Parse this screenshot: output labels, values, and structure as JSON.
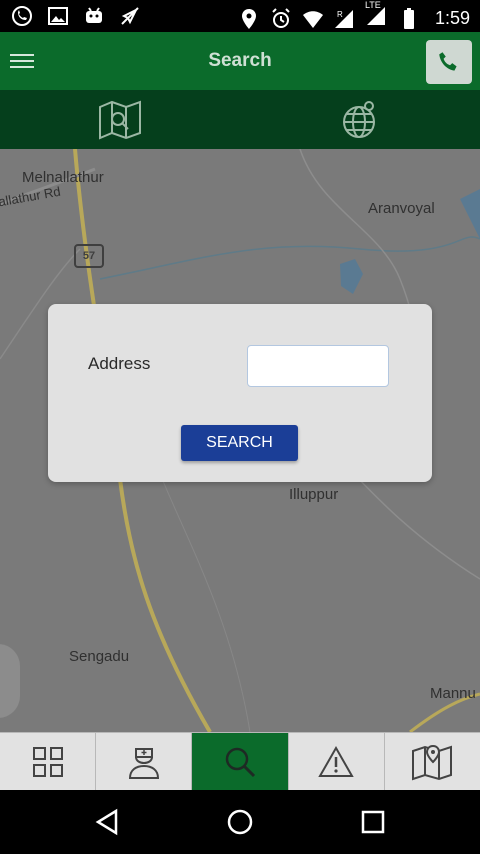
{
  "status_bar": {
    "time": "1:59",
    "left_icons": [
      "whatsapp-icon",
      "gallery-icon",
      "android-icon",
      "no-gps-icon"
    ],
    "right_icons": [
      "location-icon",
      "alarm-icon",
      "wifi-icon",
      "signal-roaming-icon",
      "signal-icon",
      "battery-icon"
    ],
    "signal_tag": "LTE"
  },
  "header": {
    "title": "Search",
    "menu_icon": "hamburger-icon",
    "phone_icon": "phone-icon",
    "bar_color": "#0b6b2b"
  },
  "sub_tabs": [
    {
      "icon": "map-search-icon"
    },
    {
      "icon": "globe-icon"
    }
  ],
  "map": {
    "labels": [
      "Melnallathur",
      "allathur Rd",
      "Aranvoyal",
      "Illuppur",
      "Sengadu",
      "Mannu"
    ],
    "route_badge": "57"
  },
  "dialog": {
    "address_label": "Address",
    "address_value": "",
    "search_button": "SEARCH"
  },
  "bottom_tabs": [
    {
      "icon": "grid-icon",
      "active": false
    },
    {
      "icon": "nurse-icon",
      "active": false
    },
    {
      "icon": "search-icon",
      "active": true
    },
    {
      "icon": "warning-icon",
      "active": false
    },
    {
      "icon": "map-pin-icon",
      "active": false
    }
  ],
  "nav_bar": {
    "buttons": [
      "back-icon",
      "home-icon",
      "recents-icon"
    ]
  },
  "colors": {
    "primary_green": "#0b6b2b",
    "dark_green": "#053f1c",
    "button_blue": "#1b3e97",
    "map_gray": "#7a7a7a"
  }
}
